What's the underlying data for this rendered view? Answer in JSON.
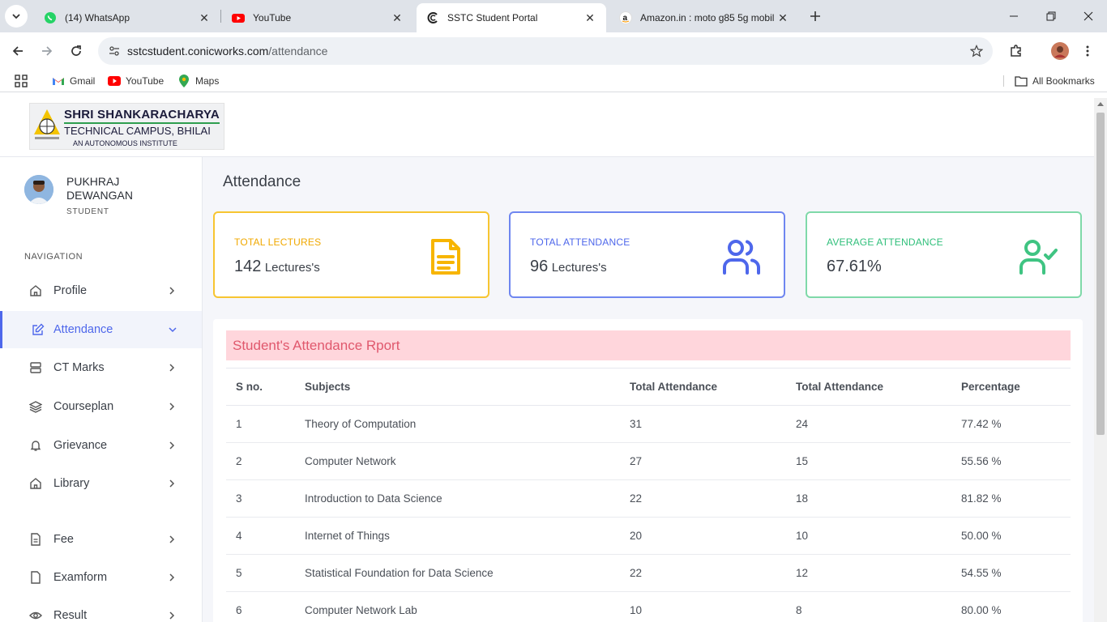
{
  "browser": {
    "tabs": [
      {
        "title": "(14) WhatsApp",
        "icon": "whatsapp-icon"
      },
      {
        "title": "YouTube",
        "icon": "youtube-icon"
      },
      {
        "title": "SSTC Student Portal",
        "icon": "portal-icon"
      },
      {
        "title": "Amazon.in : moto g85 5g mobil",
        "icon": "amazon-icon"
      }
    ],
    "url_host": "sstcstudent.conicworks.com",
    "url_path": "/attendance",
    "bookmarks": [
      {
        "label": "Gmail"
      },
      {
        "label": "YouTube"
      },
      {
        "label": "Maps"
      }
    ],
    "all_bookmarks": "All Bookmarks"
  },
  "logo": {
    "line1": "SHRI SHANKARACHARYA",
    "line2": "TECHNICAL CAMPUS, BHILAI",
    "line3": "AN AUTONOMOUS INSTITUTE"
  },
  "user": {
    "name": "PUKHRAJ DEWANGAN",
    "role": "STUDENT"
  },
  "nav": {
    "heading": "NAVIGATION",
    "items": [
      {
        "label": "Profile",
        "icon": "home-icon"
      },
      {
        "label": "Attendance",
        "icon": "edit-icon"
      },
      {
        "label": "CT Marks",
        "icon": "server-icon"
      },
      {
        "label": "Courseplan",
        "icon": "layers-icon"
      },
      {
        "label": "Grievance",
        "icon": "bell-icon"
      },
      {
        "label": "Library",
        "icon": "home-icon"
      },
      {
        "label": "Fee",
        "icon": "file-icon"
      },
      {
        "label": "Examform",
        "icon": "file-icon"
      },
      {
        "label": "Result",
        "icon": "eye-icon"
      }
    ]
  },
  "page_title": "Attendance",
  "cards": [
    {
      "label": "TOTAL LECTURES",
      "value": "142",
      "unit": "Lectures's",
      "color": "#f7b500"
    },
    {
      "label": "TOTAL ATTENDANCE",
      "value": "96",
      "unit": "Lectures's",
      "color": "#4e67eb"
    },
    {
      "label": "AVERAGE ATTENDANCE",
      "value": "67.61%",
      "unit": "",
      "color": "#3fc482"
    }
  ],
  "report": {
    "title": "Student's Attendance Rport",
    "headers": [
      "S no.",
      "Subjects",
      "Total Attendance",
      "Total Attendance",
      "Percentage"
    ],
    "rows": [
      [
        "1",
        "Theory of Computation",
        "31",
        "24",
        "77.42 %"
      ],
      [
        "2",
        "Computer Network",
        "27",
        "15",
        "55.56 %"
      ],
      [
        "3",
        "Introduction to Data Science",
        "22",
        "18",
        "81.82 %"
      ],
      [
        "4",
        "Internet of Things",
        "20",
        "10",
        "50.00 %"
      ],
      [
        "5",
        "Statistical Foundation for Data Science",
        "22",
        "12",
        "54.55 %"
      ],
      [
        "6",
        "Computer Network Lab",
        "10",
        "8",
        "80.00 %"
      ]
    ]
  }
}
